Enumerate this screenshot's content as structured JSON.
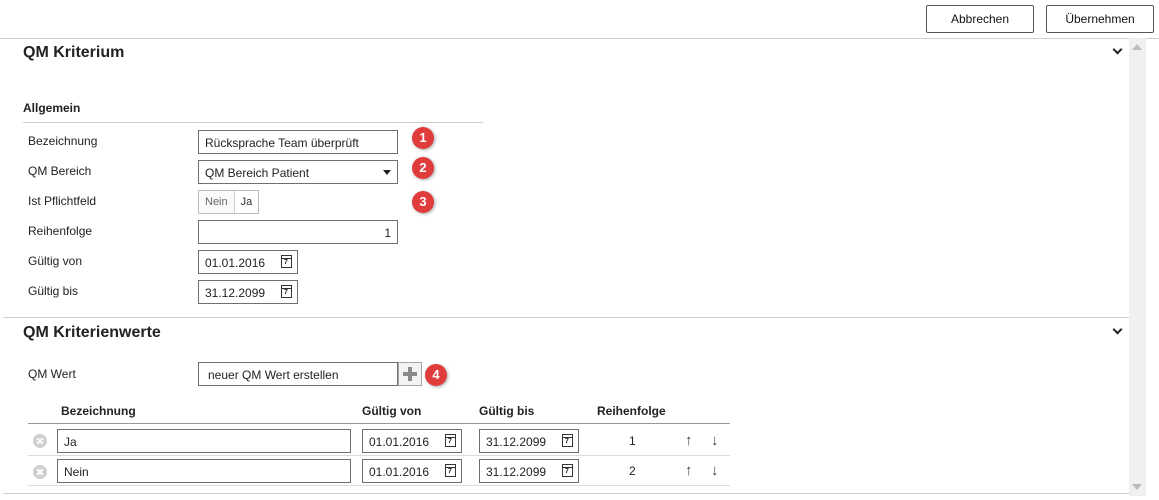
{
  "toolbar": {
    "cancel_label": "Abbrechen",
    "apply_label": "Übernehmen"
  },
  "criterion": {
    "title": "QM Kriterium",
    "group_title": "Allgemein",
    "fields": {
      "bezeichnung": {
        "label": "Bezeichnung",
        "value": "Rücksprache Team überprüft"
      },
      "bereich": {
        "label": "QM Bereich",
        "value": "QM Bereich Patient"
      },
      "pflichtfeld": {
        "label": "Ist Pflichtfeld",
        "options": [
          "Nein",
          "Ja"
        ],
        "selected": "Ja"
      },
      "reihenfolge": {
        "label": "Reihenfolge",
        "value": "1"
      },
      "gueltig_von": {
        "label": "Gültig von",
        "value": "01.01.2016"
      },
      "gueltig_bis": {
        "label": "Gültig bis",
        "value": "31.12.2099"
      }
    },
    "badges": [
      "1",
      "2",
      "3"
    ]
  },
  "values_section": {
    "title": "QM Kriterienwerte",
    "qm_wert_label": "QM Wert",
    "new_value_placeholder": "neuer QM Wert erstellen",
    "badge": "4",
    "columns": [
      "Bezeichnung",
      "Gültig von",
      "Gültig bis",
      "Reihenfolge"
    ],
    "rows": [
      {
        "bezeichnung": "Ja",
        "von": "01.01.2016",
        "bis": "31.12.2099",
        "reihenfolge": "1"
      },
      {
        "bezeichnung": "Nein",
        "von": "01.01.2016",
        "bis": "31.12.2099",
        "reihenfolge": "2"
      }
    ]
  },
  "icons": {
    "calendar": "calendar-icon",
    "remove": "remove-circle-icon",
    "up": "arrow-up-icon",
    "down": "arrow-down-icon",
    "add": "plus-icon",
    "collapse": "chevron-down-icon"
  },
  "colors": {
    "badge": "#e03c3c",
    "border": "#707070"
  }
}
